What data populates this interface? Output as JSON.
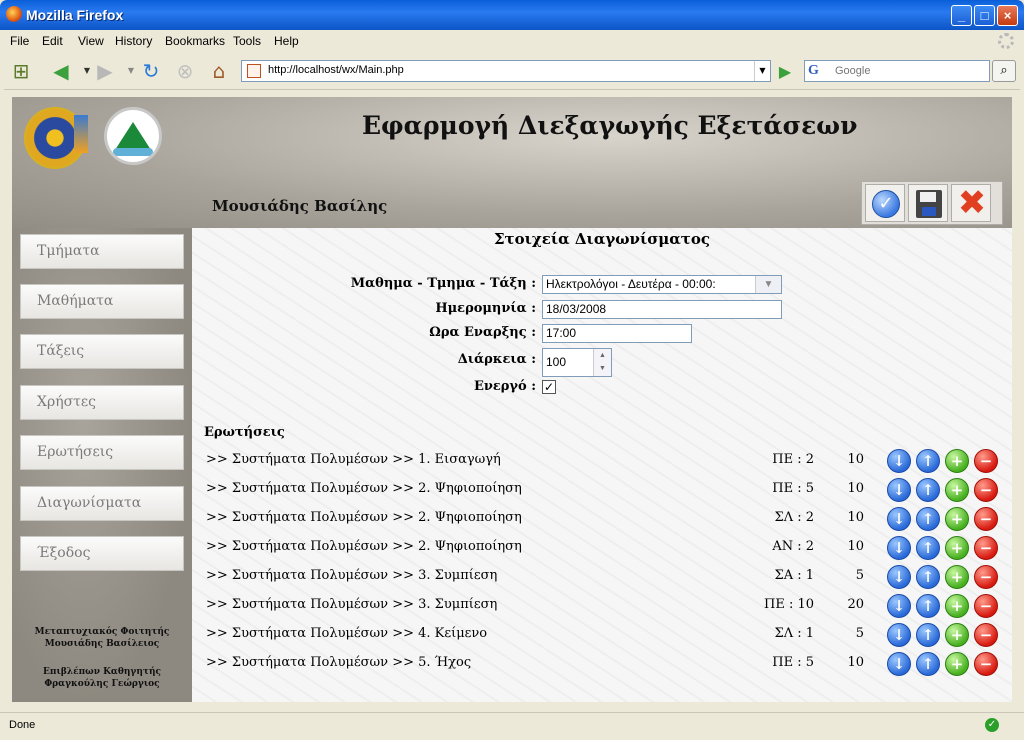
{
  "window": {
    "title": "Mozilla Firefox"
  },
  "menu": [
    "File",
    "Edit",
    "View",
    "History",
    "Bookmarks",
    "Tools",
    "Help"
  ],
  "navbar": {
    "url": "http://localhost/wx/Main.php",
    "search_placeholder": "Google"
  },
  "header": {
    "app_title": "Εφαρμογή Διεξαγωγής Εξετάσεων",
    "user_name": "Μουσιάδης Βασίλης"
  },
  "sidebar": {
    "items": [
      "Τμήματα",
      "Μαθήματα",
      "Τάξεις",
      "Χρήστες",
      "Ερωτήσεις",
      "Διαγωνίσματα",
      "Έξοδος"
    ],
    "footer": {
      "line1": "Μεταπτυχιακός Φοιτητής",
      "line2": "Μουσιάδης Βασίλειος",
      "line3": "Επιβλέπων Καθηγητής",
      "line4": "Φραγκούλης Γεώργιος"
    }
  },
  "form": {
    "title": "Στοιχεία Διαγωνίσματος",
    "course_label": "Μαθημα - Τμημα - Τάξη :",
    "course_value": "Ηλεκτρολόγοι - Δευτέρα - 00:00:",
    "date_label": "Ημερομηνία :",
    "date_value": "18/03/2008",
    "start_label": "Ωρα Εναρξης :",
    "start_value": "17:00",
    "duration_label": "Διάρκεια :",
    "duration_value": "100",
    "active_label": "Ενεργό :",
    "active_mark": "✓"
  },
  "questions": {
    "heading": "Ερωτήσεις",
    "rows": [
      {
        "path": ">> Συστήματα Πολυμέσων >> 1. Εισαγωγή",
        "code": "ΠΕ : 2",
        "points": "10"
      },
      {
        "path": ">> Συστήματα Πολυμέσων >> 2. Ψηφιοποίηση",
        "code": "ΠΕ : 5",
        "points": "10"
      },
      {
        "path": ">> Συστήματα Πολυμέσων >> 2. Ψηφιοποίηση",
        "code": "ΣΛ : 2",
        "points": "10"
      },
      {
        "path": ">> Συστήματα Πολυμέσων >> 2. Ψηφιοποίηση",
        "code": "ΑΝ : 2",
        "points": "10"
      },
      {
        "path": ">> Συστήματα Πολυμέσων >> 3. Συμπίεση",
        "code": "ΣΑ : 1",
        "points": "5"
      },
      {
        "path": ">> Συστήματα Πολυμέσων >> 3. Συμπίεση",
        "code": "ΠΕ : 10",
        "points": "20"
      },
      {
        "path": ">> Συστήματα Πολυμέσων >> 4. Κείμενο",
        "code": "ΣΛ : 1",
        "points": "5"
      },
      {
        "path": ">> Συστήματα Πολυμέσων >> 5. Ήχος",
        "code": "ΠΕ : 5",
        "points": "10"
      }
    ]
  },
  "status": {
    "text": "Done"
  }
}
